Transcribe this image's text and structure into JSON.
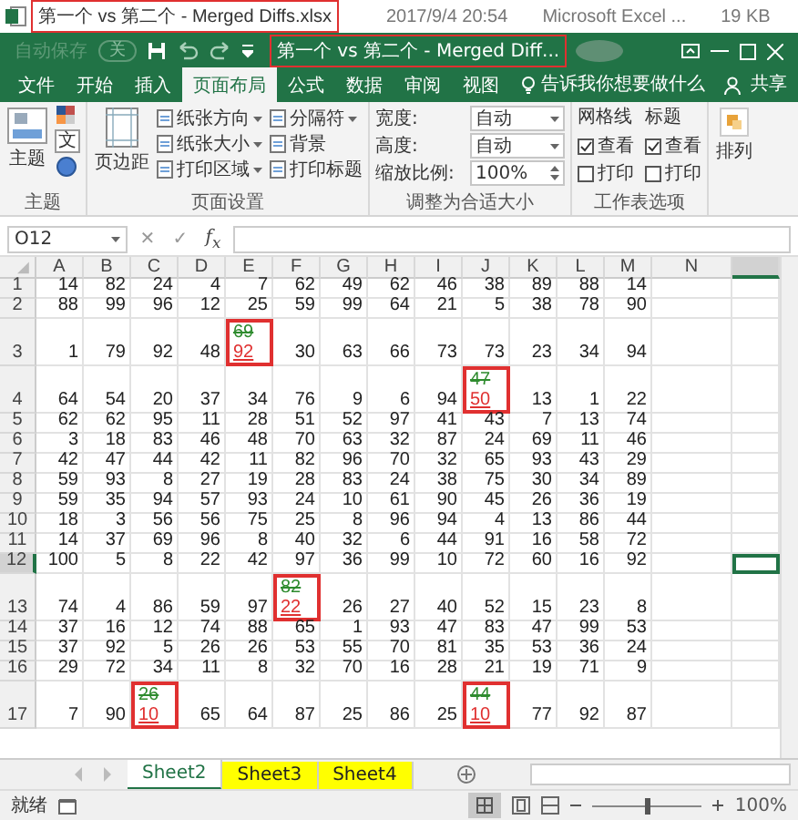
{
  "file_row": {
    "name": "第一个 vs 第二个 - Merged Diffs.xlsx",
    "annotated": true,
    "date": "2017/9/4 20:54",
    "type": "Microsoft Excel ...",
    "size": "19 KB"
  },
  "title_bar": {
    "autosave": "自动保存",
    "autosave_state": "关",
    "title": "第一个 vs 第二个 - Merged Diff...",
    "annotated": true
  },
  "tabs": [
    {
      "label": "文件",
      "selected": false
    },
    {
      "label": "开始",
      "selected": false
    },
    {
      "label": "插入",
      "selected": false
    },
    {
      "label": "页面布局",
      "selected": true
    },
    {
      "label": "公式",
      "selected": false
    },
    {
      "label": "数据",
      "selected": false
    },
    {
      "label": "审阅",
      "selected": false
    },
    {
      "label": "视图",
      "selected": false
    }
  ],
  "tell_me": "告诉我你想要做什么",
  "share": "共享",
  "ribbon": {
    "themes": {
      "label": "主题",
      "button": "主题",
      "fonts_glyph": "文"
    },
    "page_setup": {
      "label": "页面设置",
      "margins": "页边距",
      "commands": [
        {
          "label": "纸张方向",
          "dropdown": true
        },
        {
          "label": "纸张大小",
          "dropdown": true
        },
        {
          "label": "打印区域",
          "dropdown": true
        },
        {
          "label": "分隔符",
          "dropdown": true
        },
        {
          "label": "背景",
          "dropdown": false
        },
        {
          "label": "打印标题",
          "dropdown": false
        }
      ]
    },
    "scale_to_fit": {
      "label": "调整为合适大小",
      "fields": [
        {
          "label": "宽度:",
          "value": "自动",
          "kind": "dropdown"
        },
        {
          "label": "高度:",
          "value": "自动",
          "kind": "dropdown"
        },
        {
          "label": "缩放比例:",
          "value": "100%",
          "kind": "spinner"
        }
      ]
    },
    "sheet_options": {
      "label": "工作表选项",
      "columns": [
        {
          "heading": "网格线",
          "options": [
            {
              "label": "查看",
              "checked": true
            },
            {
              "label": "打印",
              "checked": false
            }
          ]
        },
        {
          "heading": "标题",
          "options": [
            {
              "label": "查看",
              "checked": true
            },
            {
              "label": "打印",
              "checked": false
            }
          ]
        }
      ]
    },
    "arrange": {
      "label": "排列"
    }
  },
  "formula_bar": {
    "name_box": "O12",
    "cancel": "✕",
    "enter": "✓",
    "function": "f$_{x}$"
  },
  "columns": [
    "A",
    "B",
    "C",
    "D",
    "E",
    "F",
    "G",
    "H",
    "I",
    "J",
    "K",
    "L",
    "M",
    "N"
  ],
  "rows": [
    {
      "header": "1",
      "selected": false,
      "cells": [
        "14",
        "82",
        "24",
        "4",
        "7",
        "62",
        "49",
        "62",
        "46",
        "38",
        "89",
        "88",
        "14"
      ]
    },
    {
      "header": "2",
      "selected": false,
      "cells": [
        "88",
        "99",
        "96",
        "12",
        "25",
        "59",
        "99",
        "64",
        "21",
        "5",
        "38",
        "78",
        "90"
      ]
    },
    {
      "header": "3",
      "selected": false,
      "cells": [
        "1",
        "79",
        "92",
        "48",
        {
          "kind": "diff",
          "old": "69",
          "new": "92"
        },
        "30",
        "63",
        "66",
        "73",
        "73",
        "23",
        "34",
        "94"
      ]
    },
    {
      "header": "4",
      "selected": false,
      "cells": [
        "64",
        "54",
        "20",
        "37",
        "34",
        "76",
        "9",
        "6",
        "94",
        {
          "kind": "diff",
          "old": "47",
          "new": "50"
        },
        "13",
        "1",
        "22"
      ]
    },
    {
      "header": "5",
      "selected": false,
      "cells": [
        "62",
        "62",
        "95",
        "11",
        "28",
        "51",
        "52",
        "97",
        "41",
        "43",
        "7",
        "13",
        "74"
      ]
    },
    {
      "header": "6",
      "selected": false,
      "cells": [
        "3",
        "18",
        "83",
        "46",
        "48",
        "70",
        "63",
        "32",
        "87",
        "24",
        "69",
        "11",
        "46"
      ]
    },
    {
      "header": "7",
      "selected": false,
      "cells": [
        "42",
        "47",
        "44",
        "42",
        "11",
        "82",
        "96",
        "70",
        "32",
        "65",
        "93",
        "43",
        "29"
      ]
    },
    {
      "header": "8",
      "selected": false,
      "cells": [
        "59",
        "93",
        "8",
        "27",
        "19",
        "28",
        "83",
        "24",
        "38",
        "75",
        "30",
        "34",
        "89"
      ]
    },
    {
      "header": "9",
      "selected": false,
      "cells": [
        "59",
        "35",
        "94",
        "57",
        "93",
        "24",
        "10",
        "61",
        "90",
        "45",
        "26",
        "36",
        "19"
      ]
    },
    {
      "header": "10",
      "selected": false,
      "cells": [
        "18",
        "3",
        "56",
        "56",
        "75",
        "25",
        "8",
        "96",
        "94",
        "4",
        "13",
        "86",
        "44"
      ]
    },
    {
      "header": "11",
      "selected": false,
      "cells": [
        "14",
        "37",
        "69",
        "96",
        "8",
        "40",
        "32",
        "6",
        "44",
        "91",
        "16",
        "58",
        "72"
      ]
    },
    {
      "header": "12",
      "selected": true,
      "cells": [
        "100",
        "5",
        "8",
        "22",
        "42",
        "97",
        "36",
        "99",
        "10",
        "72",
        "60",
        "16",
        "92"
      ]
    },
    {
      "header": "13",
      "selected": false,
      "cells": [
        "74",
        "4",
        "86",
        "59",
        "97",
        {
          "kind": "diff",
          "old": "82",
          "new": "22"
        },
        "26",
        "27",
        "40",
        "52",
        "15",
        "23",
        "8"
      ]
    },
    {
      "header": "14",
      "selected": false,
      "cells": [
        "37",
        "16",
        "12",
        "74",
        "88",
        "65",
        "1",
        "93",
        "47",
        "83",
        "47",
        "99",
        "53"
      ]
    },
    {
      "header": "15",
      "selected": false,
      "cells": [
        "37",
        "92",
        "5",
        "26",
        "26",
        "53",
        "55",
        "70",
        "81",
        "35",
        "53",
        "36",
        "24"
      ]
    },
    {
      "header": "16",
      "selected": false,
      "cells": [
        "29",
        "72",
        "34",
        "11",
        "8",
        "32",
        "70",
        "16",
        "28",
        "21",
        "19",
        "71",
        "9"
      ]
    },
    {
      "header": "17",
      "selected": false,
      "cells": [
        "7",
        "90",
        {
          "kind": "diff",
          "old": "26",
          "new": "10"
        },
        "65",
        "64",
        "87",
        "25",
        "86",
        "25",
        {
          "kind": "diff",
          "old": "44",
          "new": "10"
        },
        "77",
        "92",
        "87"
      ]
    }
  ],
  "sheets": [
    {
      "label": "Sheet2",
      "selected": true
    },
    {
      "label": "Sheet3",
      "selected": false,
      "color": "#ffff00"
    },
    {
      "label": "Sheet4",
      "selected": false,
      "color": "#ffff00"
    }
  ],
  "status_bar": {
    "text": "就绪",
    "zoom": "100%",
    "zoom_slider": {
      "level": 0.5
    }
  }
}
